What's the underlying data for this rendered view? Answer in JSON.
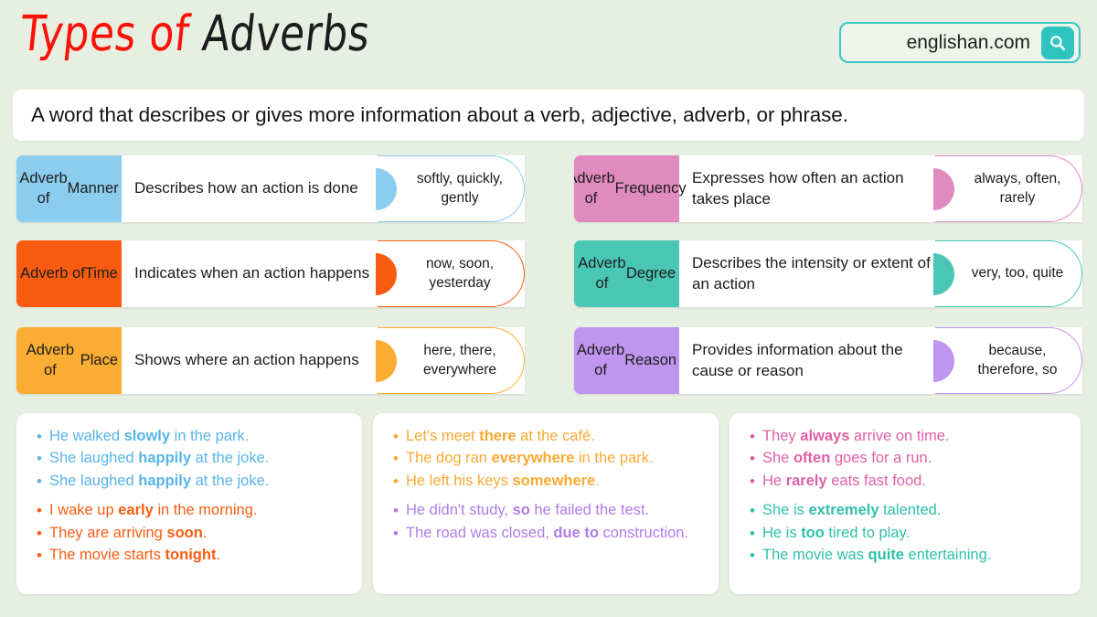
{
  "header": {
    "title_red": "Types of ",
    "title_black": "Adverbs",
    "brand_text": "englishan.com",
    "search_icon": "search-icon"
  },
  "definition": {
    "text": "A word that describes or gives more information about a verb, adjective, adverb, or phrase."
  },
  "colors": {
    "background": "#e7efe2",
    "manner": "#8ccdef",
    "time": "#f95c10",
    "place": "#fbad33",
    "frequency": "#e08bc0",
    "degree": "#4ac7b4",
    "reason": "#bf95ee",
    "brand_teal": "#2ec4c0",
    "title_red": "#fc1107"
  },
  "cards": [
    {
      "label": "Adverb of Manner",
      "label_line1": "Adverb of",
      "label_line2": "Manner",
      "description": "Describes how an action is done",
      "examples": "softly, quickly, gently",
      "color": "#8ccdef",
      "column": "left",
      "row": 0
    },
    {
      "label": "Adverb of Time",
      "label_line1": "Adverb of",
      "label_line2": "Time",
      "description": "Indicates when an action happens",
      "examples": "now, soon, yesterday",
      "color": "#f95c10",
      "column": "left",
      "row": 1
    },
    {
      "label": "Adverb of Place",
      "label_line1": "Adverb of",
      "label_line2": "Place",
      "description": "Shows where an action happens",
      "examples": "here, there, everywhere",
      "color": "#fbad33",
      "column": "left",
      "row": 2
    },
    {
      "label": "Adverb of Frequency",
      "label_line1": "Adverb of",
      "label_line2": "Frequency",
      "description": "Expresses how often an action takes place",
      "examples": "always, often, rarely",
      "color": "#e08bc0",
      "column": "right",
      "row": 0
    },
    {
      "label": "Adverb of Degree",
      "label_line1": "Adverb of",
      "label_line2": "Degree",
      "description": "Describes the intensity or extent of an action",
      "examples": "very, too, quite",
      "color": "#4ac7b4",
      "column": "right",
      "row": 1
    },
    {
      "label": "Adverb of Reason",
      "label_line1": "Adverb of",
      "label_line2": "Reason",
      "description": "Provides information about the cause or reason",
      "examples": "because, therefore, so",
      "color": "#bf95ee",
      "column": "right",
      "row": 2
    }
  ],
  "example_boxes": [
    {
      "groups": [
        {
          "color": "#58b4e8",
          "items": [
            {
              "pre": "He walked ",
              "bold": "slowly",
              "post": " in the park."
            },
            {
              "pre": "She laughed ",
              "bold": "happily",
              "post": " at the joke."
            },
            {
              "pre": "She laughed ",
              "bold": "happily",
              "post": " at the joke."
            }
          ]
        },
        {
          "color": "#f95c10",
          "items": [
            {
              "pre": "I wake up ",
              "bold": "early",
              "post": " in the morning."
            },
            {
              "pre": "They are arriving ",
              "bold": "soon",
              "post": "."
            },
            {
              "pre": "The movie starts ",
              "bold": "tonight",
              "post": "."
            }
          ]
        }
      ]
    },
    {
      "groups": [
        {
          "color": "#f9a932",
          "items": [
            {
              "pre": "Let's meet ",
              "bold": "there",
              "post": " at the café."
            },
            {
              "pre": "The dog ran ",
              "bold": "everywhere",
              "post": " in the park."
            },
            {
              "pre": "He left his keys ",
              "bold": "somewhere",
              "post": "."
            }
          ]
        },
        {
          "color": "#b07ce8",
          "items": [
            {
              "pre": "He didn't study, ",
              "bold": "so",
              "post": " he failed the test."
            },
            {
              "pre": "The road was closed, ",
              "bold": "due to",
              "post": " construction."
            }
          ]
        }
      ]
    },
    {
      "groups": [
        {
          "color": "#de5fa5",
          "items": [
            {
              "pre": "They ",
              "bold": "always",
              "post": " arrive on time."
            },
            {
              "pre": "She ",
              "bold": "often",
              "post": " goes for a run."
            },
            {
              "pre": "He ",
              "bold": "rarely",
              "post": " eats fast food."
            }
          ]
        },
        {
          "color": "#2fc0ab",
          "items": [
            {
              "pre": "She is ",
              "bold": "extremely",
              "post": " talented."
            },
            {
              "pre": "He is ",
              "bold": "too",
              "post": " tired to play."
            },
            {
              "pre": "The movie was ",
              "bold": "quite",
              "post": " entertaining."
            }
          ]
        }
      ]
    }
  ],
  "bullet_glyph": "•"
}
